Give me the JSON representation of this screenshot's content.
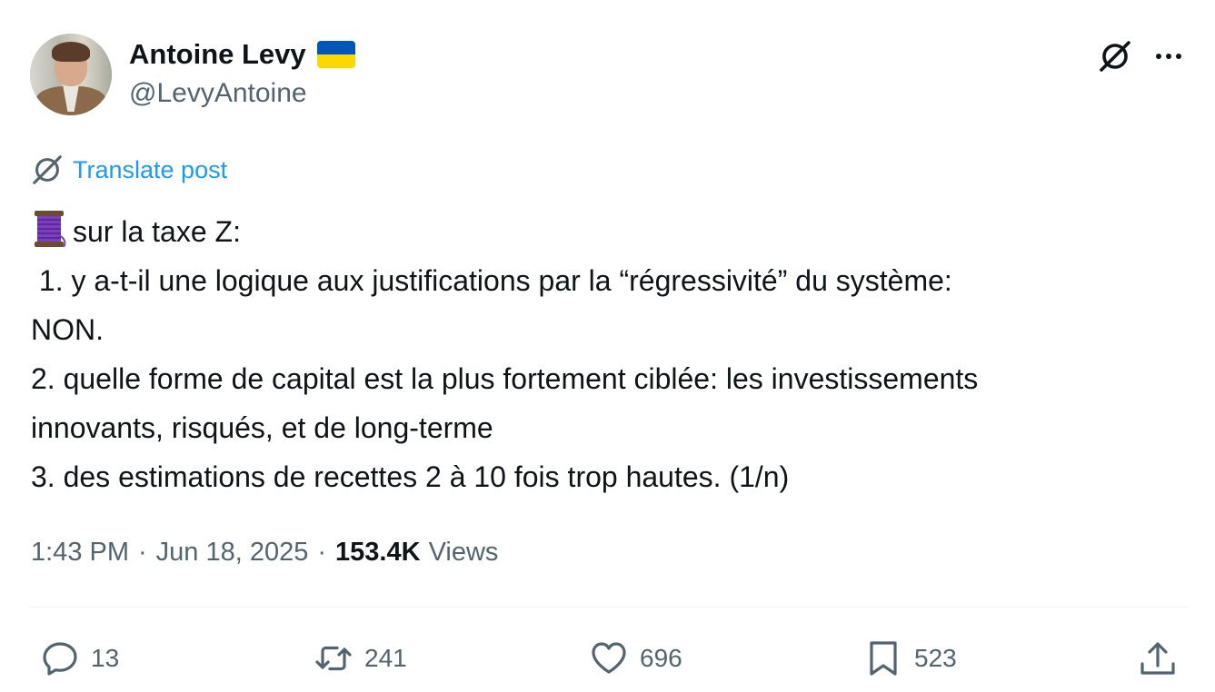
{
  "author": {
    "display_name": "Antoine Levy",
    "handle": "@LevyAntoine",
    "flag_colors": {
      "top": "#0057b7",
      "bottom": "#ffd700"
    }
  },
  "header_actions": {
    "grok_icon": "grok-icon",
    "more_icon": "more-icon"
  },
  "translate": {
    "icon": "grok-icon",
    "label": "Translate post",
    "color": "#1d9bf0"
  },
  "tweet": {
    "lines": [
      "sur la taxe Z:",
      " 1. y a-t-il une logique aux justifications par la “régressivité” du système:",
      "NON.",
      "2. quelle forme de capital est la plus fortement ciblée: les investissements",
      "innovants, risqués, et de long-terme",
      "3. des estimations de recettes 2 à 10 fois trop hautes. (1/n)"
    ],
    "leading_emoji": "spool-of-thread-icon"
  },
  "meta": {
    "time": "1:43 PM",
    "separator": "·",
    "date": "Jun 18, 2025",
    "views_count": "153.4K",
    "views_label": "Views"
  },
  "actions": {
    "replies": {
      "icon": "reply-icon",
      "count": "13"
    },
    "reposts": {
      "icon": "repost-icon",
      "count": "241"
    },
    "likes": {
      "icon": "heart-icon",
      "count": "696"
    },
    "bookmarks": {
      "icon": "bookmark-icon",
      "count": "523"
    },
    "share": {
      "icon": "share-icon"
    }
  },
  "colors": {
    "text_primary": "#0f1419",
    "text_secondary": "#536471",
    "link": "#1d9bf0",
    "divider": "#eff3f4"
  }
}
